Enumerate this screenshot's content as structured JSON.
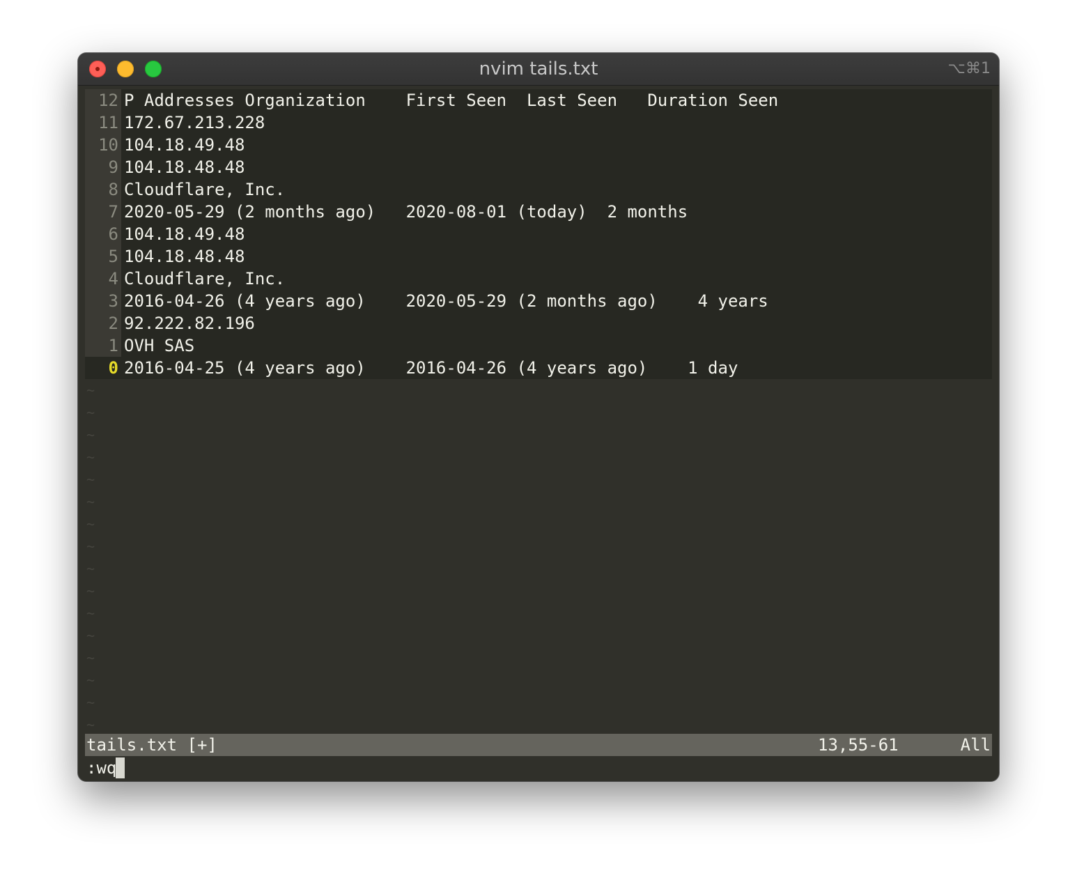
{
  "window": {
    "title": "nvim tails.txt",
    "shortcut": "⌥⌘1"
  },
  "buffer": {
    "lines": [
      {
        "num": "12",
        "text": "P Addresses Organization    First Seen  Last Seen   Duration Seen"
      },
      {
        "num": "11",
        "text": "172.67.213.228"
      },
      {
        "num": "10",
        "text": "104.18.49.48"
      },
      {
        "num": "9",
        "text": "104.18.48.48"
      },
      {
        "num": "8",
        "text": "Cloudflare, Inc."
      },
      {
        "num": "7",
        "text": "2020-05-29 (2 months ago)   2020-08-01 (today)  2 months"
      },
      {
        "num": "6",
        "text": "104.18.49.48"
      },
      {
        "num": "5",
        "text": "104.18.48.48"
      },
      {
        "num": "4",
        "text": "Cloudflare, Inc."
      },
      {
        "num": "3",
        "text": "2016-04-26 (4 years ago)    2020-05-29 (2 months ago)    4 years"
      },
      {
        "num": "2",
        "text": "92.222.82.196"
      },
      {
        "num": "1",
        "text": "OVH SAS"
      },
      {
        "num": "0",
        "text": "2016-04-25 (4 years ago)    2016-04-26 (4 years ago)    1 day"
      }
    ],
    "tilde": "~"
  },
  "statusline": {
    "file": "tails.txt [+]",
    "position": "13,55-61",
    "scroll": "All"
  },
  "cmdline": {
    "text": ":wq"
  },
  "colors": {
    "background": "#30302a",
    "line_background": "#272822",
    "gutter_background": "#3b3a34",
    "current_line_number": "#e6db29",
    "statusline_background": "#65645d",
    "text": "#f2f2ea"
  }
}
